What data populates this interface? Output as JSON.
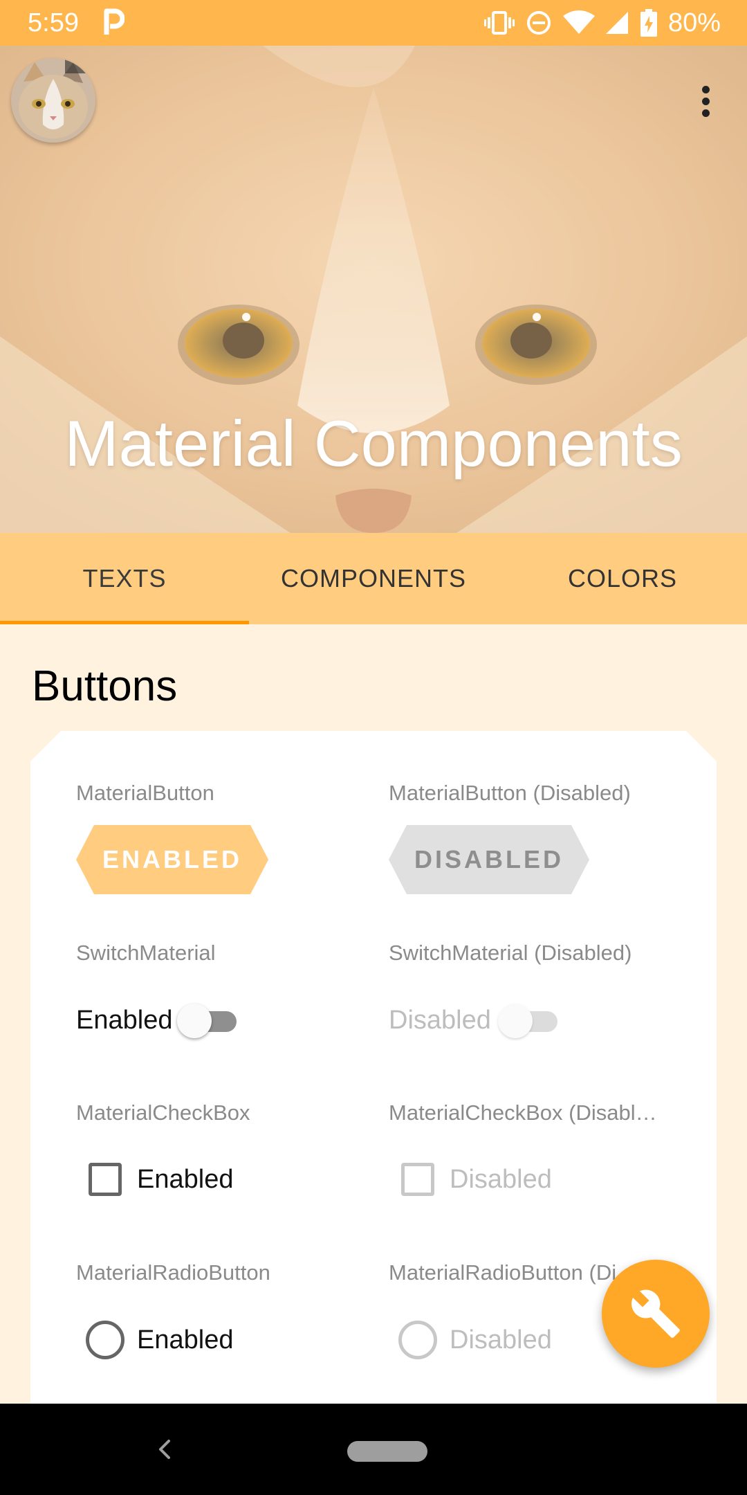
{
  "status_bar": {
    "time": "5:59",
    "app_icon": "p-icon",
    "battery": "80%",
    "icons": [
      "vibrate-icon",
      "do-not-disturb-icon",
      "wifi-icon",
      "signal-icon",
      "battery-charging-icon"
    ]
  },
  "header": {
    "title": "Material Components",
    "avatar": "cat-avatar",
    "menu_icon": "more-vert-icon"
  },
  "tabs": [
    {
      "label": "TEXTS",
      "active": true
    },
    {
      "label": "COMPONENTS",
      "active": false
    },
    {
      "label": "COLORS",
      "active": false
    }
  ],
  "section": {
    "title": "Buttons"
  },
  "components": {
    "material_button": {
      "label": "MaterialButton",
      "button": "ENABLED"
    },
    "material_button_disabled": {
      "label": "MaterialButton (Disabled)",
      "button": "DISABLED"
    },
    "switch": {
      "label": "SwitchMaterial",
      "text": "Enabled",
      "checked": false
    },
    "switch_disabled": {
      "label": "SwitchMaterial (Disabled)",
      "text": "Disabled",
      "checked": false
    },
    "checkbox": {
      "label": "MaterialCheckBox",
      "text": "Enabled",
      "checked": false
    },
    "checkbox_disabled": {
      "label": "MaterialCheckBox (Disabl…",
      "text": "Disabled",
      "checked": false
    },
    "radio": {
      "label": "MaterialRadioButton",
      "text": "Enabled",
      "checked": false
    },
    "radio_disabled": {
      "label": "MaterialRadioButton (Di",
      "text": "Disabled",
      "checked": false
    }
  },
  "fab": {
    "icon": "wrench-icon"
  },
  "colors": {
    "status_bar": "#FFB74D",
    "tab_bar": "#FFCC80",
    "tab_indicator": "#FF9800",
    "background": "#FFF3E0",
    "fab": "#FFA726",
    "button_enabled": "#FFCC80",
    "button_disabled": "#E0E0E0"
  },
  "nav_bar": {
    "back_icon": "back-chevron-icon",
    "home_icon": "home-pill-icon"
  }
}
